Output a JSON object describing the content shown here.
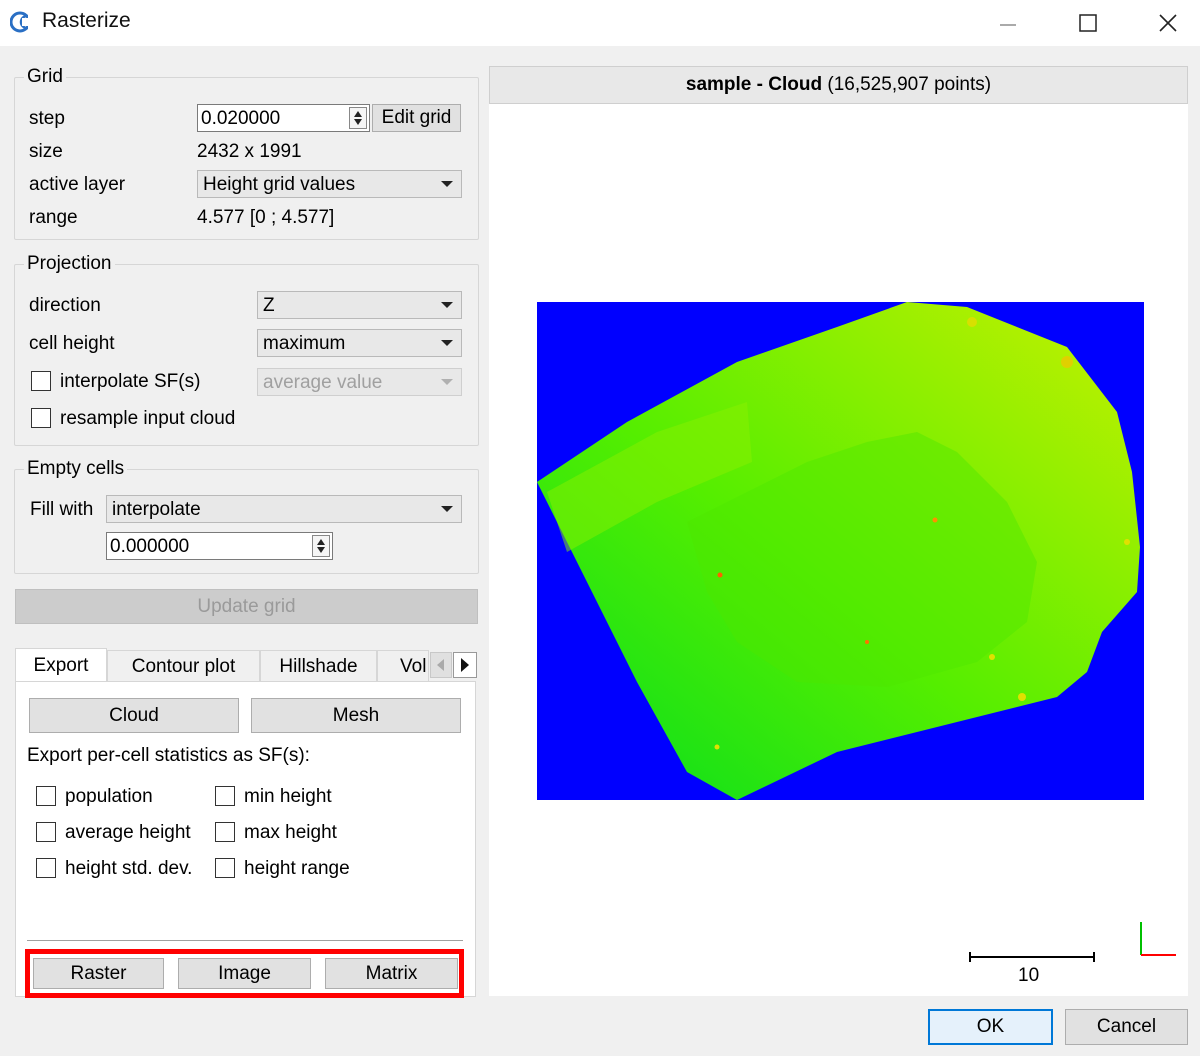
{
  "window": {
    "title": "Rasterize",
    "app_icon": "cc-logo-icon"
  },
  "grid": {
    "group_title": "Grid",
    "step_label": "step",
    "step_value": "0.020000",
    "edit_grid_label": "Edit grid",
    "size_label": "size",
    "size_value": "2432 x 1991",
    "active_layer_label": "active layer",
    "active_layer_value": "Height grid values",
    "range_label": "range",
    "range_value": "4.577 [0 ; 4.577]"
  },
  "projection": {
    "group_title": "Projection",
    "direction_label": "direction",
    "direction_value": "Z",
    "cell_height_label": "cell height",
    "cell_height_value": "maximum",
    "interpolate_label": "interpolate SF(s)",
    "interpolate_value": "average value",
    "resample_label": "resample input cloud"
  },
  "empty_cells": {
    "group_title": "Empty cells",
    "fill_with_label": "Fill with",
    "fill_with_value": "interpolate",
    "fill_number": "0.000000"
  },
  "update_grid_label": "Update grid",
  "tabs": [
    "Export",
    "Contour plot",
    "Hillshade",
    "Vol"
  ],
  "export": {
    "cloud_label": "Cloud",
    "mesh_label": "Mesh",
    "stats_label": "Export per-cell statistics as SF(s):",
    "stats": [
      "population",
      "min height",
      "average height",
      "max height",
      "height std. dev.",
      "height range"
    ],
    "raster_label": "Raster",
    "image_label": "Image",
    "matrix_label": "Matrix"
  },
  "viewer": {
    "title_name": "sample",
    "title_sep": " - ",
    "title_cloud": "Cloud",
    "title_points": " (16,525,907 points)",
    "scale_label": "10",
    "background_color": "#0000ff",
    "cloud_color": "#66ee00"
  },
  "ok_label": "OK",
  "cancel_label": "Cancel",
  "highlight_color": "#ff0000"
}
